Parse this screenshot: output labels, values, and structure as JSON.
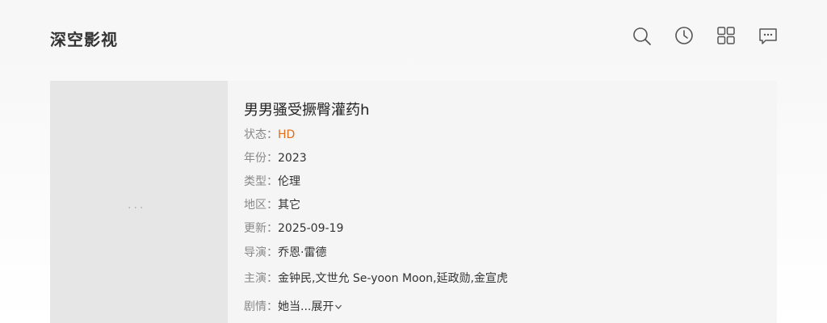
{
  "site": {
    "logo": "深空影视"
  },
  "header_icons": [
    "search-icon",
    "history-icon",
    "grid-icon",
    "chat-icon"
  ],
  "poster": {
    "loading": "···"
  },
  "movie": {
    "title": "男男骚受撅臀灌药h",
    "fields": [
      {
        "label": "状态：",
        "value": "HD"
      },
      {
        "label": "年份：",
        "value": "2023"
      },
      {
        "label": "类型：",
        "value": "伦理"
      },
      {
        "label": "地区：",
        "value": "其它"
      },
      {
        "label": "更新：",
        "value": "2025-09-19"
      },
      {
        "label": "导演：",
        "value": "乔恩·雷德"
      },
      {
        "label": "主演：",
        "value": "金钟民,文世允 Se-yoon Moon,延政勋,金宣虎"
      }
    ],
    "plot": {
      "label": "剧情：",
      "value": "她当...",
      "expand_label": "展开"
    }
  },
  "colors": {
    "status": "#e06d1c",
    "background": "#f7f7f7",
    "poster": "#e6e6e6"
  }
}
